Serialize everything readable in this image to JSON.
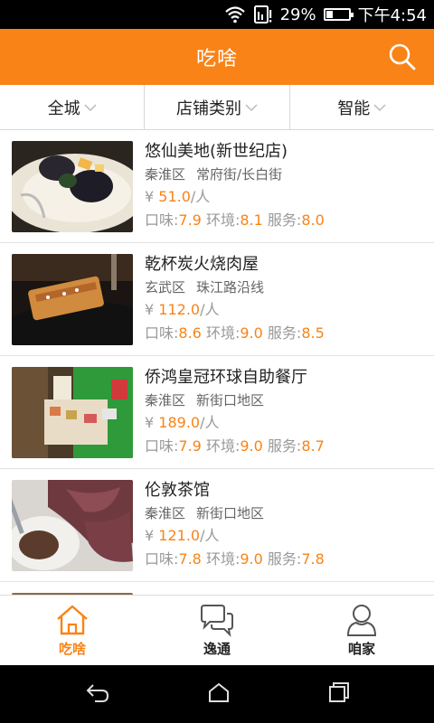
{
  "status_bar": {
    "battery_percent": "29%",
    "time": "下午4:54",
    "battery_level": 0.29
  },
  "header": {
    "title": "吃啥",
    "search_icon": "search-icon"
  },
  "filters": [
    {
      "label": "全城"
    },
    {
      "label": "店铺类别"
    },
    {
      "label": "智能"
    }
  ],
  "restaurants": [
    {
      "name": "悠仙美地(新世纪店)",
      "district": "秦淮区",
      "area": "常府街/长白街",
      "currency": "¥",
      "price": "51.0",
      "unit": "/人",
      "taste_label": "口味:",
      "taste": "7.9",
      "env_label": "环境:",
      "env": "8.1",
      "service_label": "服务:",
      "service": "8.0"
    },
    {
      "name": "乾杯炭火烧肉屋",
      "district": "玄武区",
      "area": "珠江路沿线",
      "currency": "¥",
      "price": "112.0",
      "unit": "/人",
      "taste_label": "口味:",
      "taste": "8.6",
      "env_label": "环境:",
      "env": "9.0",
      "service_label": "服务:",
      "service": "8.5"
    },
    {
      "name": "侨鸿皇冠环球自助餐厅",
      "district": "秦淮区",
      "area": "新街口地区",
      "currency": "¥",
      "price": "189.0",
      "unit": "/人",
      "taste_label": "口味:",
      "taste": "7.9",
      "env_label": "环境:",
      "env": "9.0",
      "service_label": "服务:",
      "service": "8.7"
    },
    {
      "name": "伦敦茶馆",
      "district": "秦淮区",
      "area": "新街口地区",
      "currency": "¥",
      "price": "121.0",
      "unit": "/人",
      "taste_label": "口味:",
      "taste": "7.8",
      "env_label": "环境:",
      "env": "9.0",
      "service_label": "服务:",
      "service": "7.8"
    }
  ],
  "tabs": [
    {
      "label": "吃啥",
      "icon": "home-icon",
      "active": true
    },
    {
      "label": "逸通",
      "icon": "chat-icon",
      "active": false
    },
    {
      "label": "咱家",
      "icon": "user-icon",
      "active": false
    }
  ],
  "colors": {
    "accent": "#f98317",
    "text": "#222222",
    "muted": "#999999"
  }
}
